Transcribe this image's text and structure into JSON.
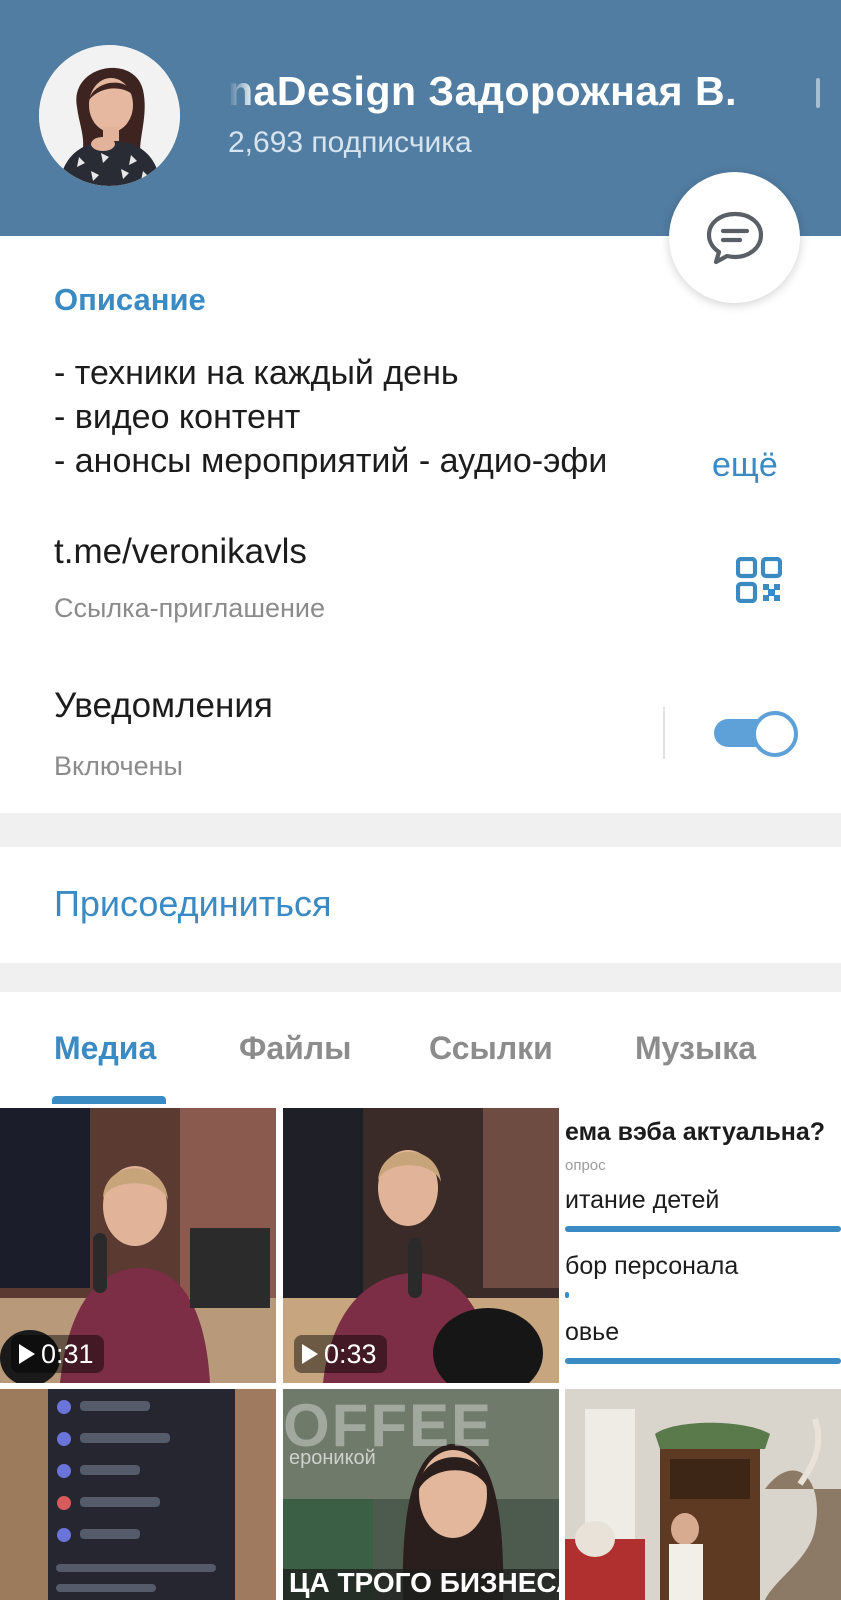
{
  "header": {
    "title": "naDesign Задорожная В.",
    "subscribers": "2,693 подписчика"
  },
  "description": {
    "heading": "Описание",
    "lines": [
      "- техники на каждый день",
      "- видео контент",
      "- анонсы мероприятий - аудио-эфи"
    ],
    "more": "ещё"
  },
  "invite": {
    "link": "t.me/veronikavls",
    "label": "Ссылка-приглашение"
  },
  "notifications": {
    "label": "Уведомления",
    "status": "Включены",
    "enabled": true
  },
  "join_label": "Присоединиться",
  "tabs": [
    {
      "label": "Медиа",
      "active": true
    },
    {
      "label": "Файлы",
      "active": false
    },
    {
      "label": "Ссылки",
      "active": false
    },
    {
      "label": "Музыка",
      "active": false
    }
  ],
  "media": {
    "videos": [
      {
        "duration": "0:31"
      },
      {
        "duration": "0:33"
      }
    ],
    "poll": {
      "question": "ема вэба актуальна?",
      "subtitle": "опрос",
      "options": [
        "итание детей",
        "бор персонала",
        "овье"
      ]
    },
    "thumb_texts": [
      "OFFEE",
      "ероникой",
      "ЦА ТРОГО БИЗНЕСА"
    ]
  },
  "colors": {
    "header": "#517da2",
    "accent": "#3a8ac4",
    "toggle": "#5ea0d8"
  }
}
